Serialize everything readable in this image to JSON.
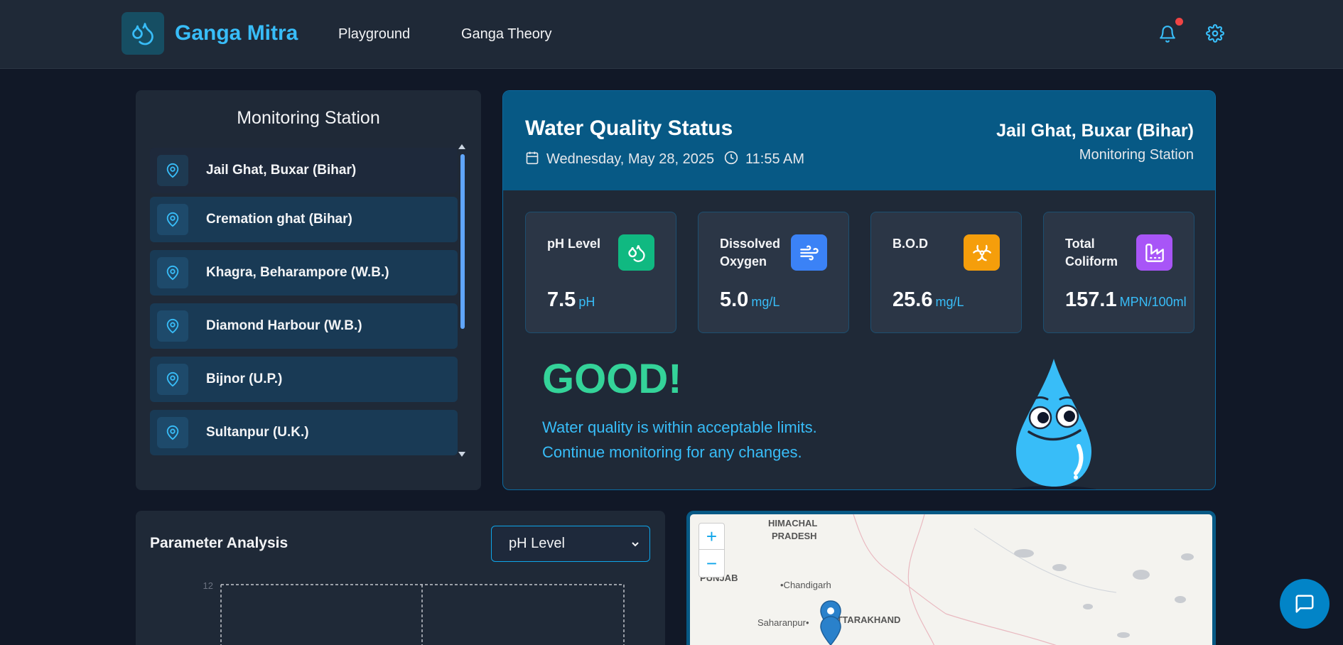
{
  "header": {
    "brand": "Ganga Mitra",
    "nav": [
      "Playground",
      "Ganga Theory"
    ]
  },
  "stations": {
    "title": "Monitoring Station",
    "items": [
      "Jail Ghat, Buxar (Bihar)",
      "Cremation ghat (Bihar)",
      "Khagra, Beharampore (W.B.)",
      "Diamond Harbour (W.B.)",
      "Bijnor (U.P.)",
      "Sultanpur (U.K.)"
    ]
  },
  "status": {
    "title": "Water Quality Status",
    "date": "Wednesday, May 28, 2025",
    "time": "11:55 AM",
    "station": "Jail Ghat, Buxar (Bihar)",
    "station_sub": "Monitoring Station",
    "metrics": [
      {
        "label": "pH Level",
        "value": "7.5",
        "unit": "pH",
        "icon": "water-drops-icon",
        "color": "#10b981"
      },
      {
        "label": "Dissolved Oxygen",
        "value": "5.0",
        "unit": "mg/L",
        "icon": "wind-icon",
        "color": "#3b82f6"
      },
      {
        "label": "B.O.D",
        "value": "25.6",
        "unit": "mg/L",
        "icon": "biohazard-icon",
        "color": "#f59e0b"
      },
      {
        "label": "Total Coliform",
        "value": "157.1",
        "unit": "MPN/100ml",
        "icon": "factory-icon",
        "color": "#a855f7"
      }
    ],
    "verdict": "GOOD!",
    "message_line1": "Water quality is within acceptable limits.",
    "message_line2": "Continue monitoring for any changes."
  },
  "analysis": {
    "title": "Parameter Analysis",
    "selected_parameter": "pH Level",
    "y_tick_top": "12"
  },
  "map": {
    "labels": [
      "HIMACHAL",
      "PRADESH",
      "PUNJAB",
      "•Chandigarh",
      "Saharanpur•",
      "UTTARAKHAND"
    ],
    "zoom_in": "+",
    "zoom_out": "−"
  },
  "colors": {
    "accent": "#38bdf8",
    "good": "#34d399",
    "header_bg": "#075985"
  }
}
